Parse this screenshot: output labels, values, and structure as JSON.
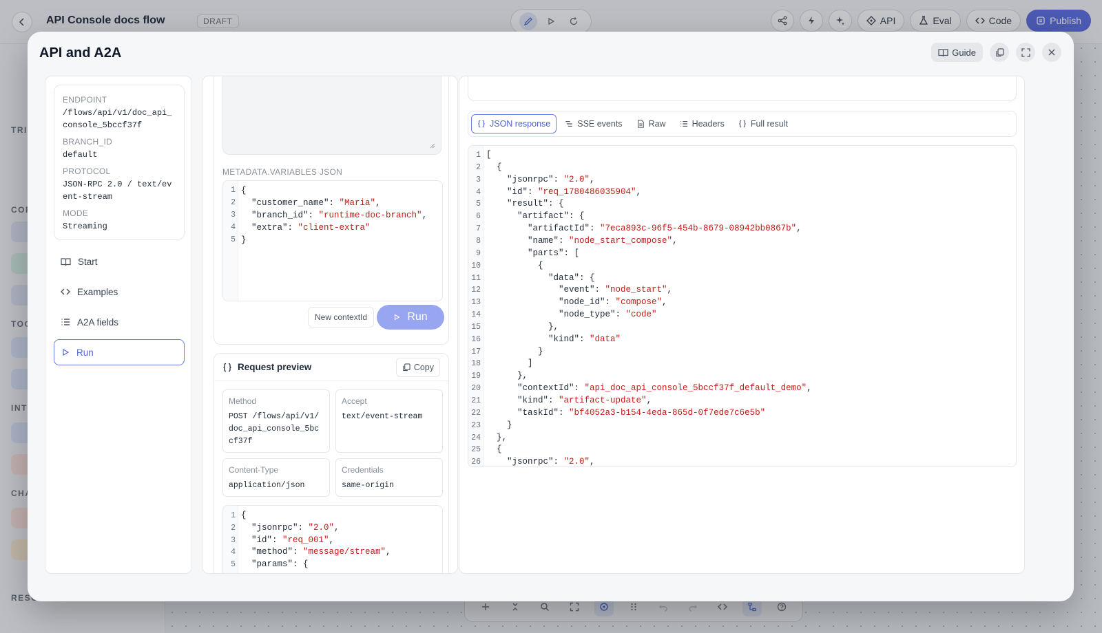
{
  "app": {
    "title": "API Console docs flow",
    "status_badge": "DRAFT",
    "toolbar": {
      "api": "API",
      "eval": "Eval",
      "code": "Code",
      "publish": "Publish"
    },
    "sidebar": {
      "sections": [
        "TRIG",
        "COR",
        "TOO",
        "INT",
        "CHA",
        "RESOURCES"
      ]
    }
  },
  "modal": {
    "title": "API and A2A",
    "guide_label": "Guide",
    "info": {
      "endpoint_label": "ENDPOINT",
      "endpoint_value": "/flows/api/v1/doc_api_console_5bccf37f",
      "branch_label": "BRANCH_ID",
      "branch_value": "default",
      "protocol_label": "PROTOCOL",
      "protocol_value": "JSON-RPC 2.0 / text/event-stream",
      "mode_label": "MODE",
      "mode_value": "Streaming"
    },
    "nav": [
      {
        "label": "Start",
        "icon": "book-icon"
      },
      {
        "label": "Examples",
        "icon": "code-icon"
      },
      {
        "label": "A2A fields",
        "icon": "list-icon"
      },
      {
        "label": "Run",
        "icon": "play-icon",
        "active": true
      }
    ],
    "metadata_label": "METADATA.VARIABLES JSON",
    "metadata_json": [
      "{",
      "  \"customer_name\": \"Maria\",",
      "  \"branch_id\": \"runtime-doc-branch\",",
      "  \"extra\": \"client-extra\"",
      "}"
    ],
    "new_context_label": "New contextId",
    "run_label": "Run",
    "preview": {
      "title": "Request preview",
      "copy_label": "Copy",
      "method_label": "Method",
      "method_value": "POST /flows/api/v1/doc_api_console_5bccf37f",
      "accept_label": "Accept",
      "accept_value": "text/event-stream",
      "content_type_label": "Content-Type",
      "content_type_value": "application/json",
      "credentials_label": "Credentials",
      "credentials_value": "same-origin",
      "body": [
        "{",
        "  \"jsonrpc\": \"2.0\",",
        "  \"id\": \"req_001\",",
        "  \"method\": \"message/stream\",",
        "  \"params\": {"
      ]
    },
    "response_tabs": [
      {
        "label": "JSON response",
        "icon": "braces-icon",
        "active": true
      },
      {
        "label": "SSE events",
        "icon": "stream-icon"
      },
      {
        "label": "Raw",
        "icon": "file-icon"
      },
      {
        "label": "Headers",
        "icon": "list-icon"
      },
      {
        "label": "Full result",
        "icon": "braces-icon"
      }
    ],
    "response_json": [
      "[",
      "  {",
      "    \"jsonrpc\": \"2.0\",",
      "    \"id\": \"req_1780486035904\",",
      "    \"result\": {",
      "      \"artifact\": {",
      "        \"artifactId\": \"7eca893c-96f5-454b-8679-08942bb0867b\",",
      "        \"name\": \"node_start_compose\",",
      "        \"parts\": [",
      "          {",
      "            \"data\": {",
      "              \"event\": \"node_start\",",
      "              \"node_id\": \"compose\",",
      "              \"node_type\": \"code\"",
      "            },",
      "            \"kind\": \"data\"",
      "          }",
      "        ]",
      "      },",
      "      \"contextId\": \"api_doc_api_console_5bccf37f_default_demo\",",
      "      \"kind\": \"artifact-update\",",
      "      \"taskId\": \"bf4052a3-b154-4eda-865d-0f7ede7c6e5b\"",
      "    }",
      "  },",
      "  {",
      "    \"jsonrpc\": \"2.0\","
    ]
  }
}
